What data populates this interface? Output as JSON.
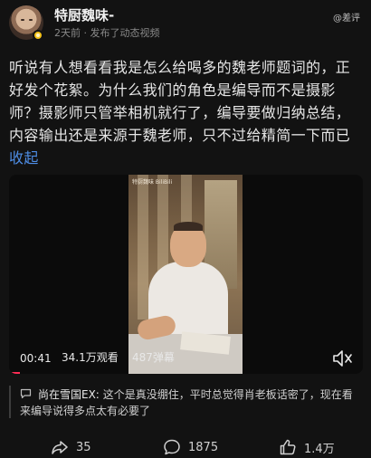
{
  "header": {
    "author": "特厨魏味-",
    "time": "2天前",
    "separator": "·",
    "action": "发布了动态视频",
    "corner_tag": "@差评"
  },
  "post": {
    "text": "听说有人想看看我是怎么给喝多的魏老师题词的，正好发个花絮。为什么我们的角色是编导而不是摄影师？摄影师只管举相机就行了，编导要做归纳总结，内容输出还是来源于魏老师，只不过给精简一下而已",
    "collapse_label": "收起"
  },
  "video": {
    "watermark": "特厨魏味 BiliBili",
    "duration": "00:41",
    "views": "34.1万观看",
    "danmaku": "487弹幕",
    "progress": 0.03
  },
  "comment": {
    "user": "尚在雪国EX:",
    "text": "这个是真没绷住，平时总觉得肖老板话密了，现在看来编导说得多点太有必要了"
  },
  "actions": {
    "share_count": "35",
    "comment_count": "1875",
    "like_count": "1.4万"
  },
  "colors": {
    "background": "#121212",
    "link": "#4e8de5",
    "badge": "#f4c21a",
    "progress": "#fe2c55"
  }
}
